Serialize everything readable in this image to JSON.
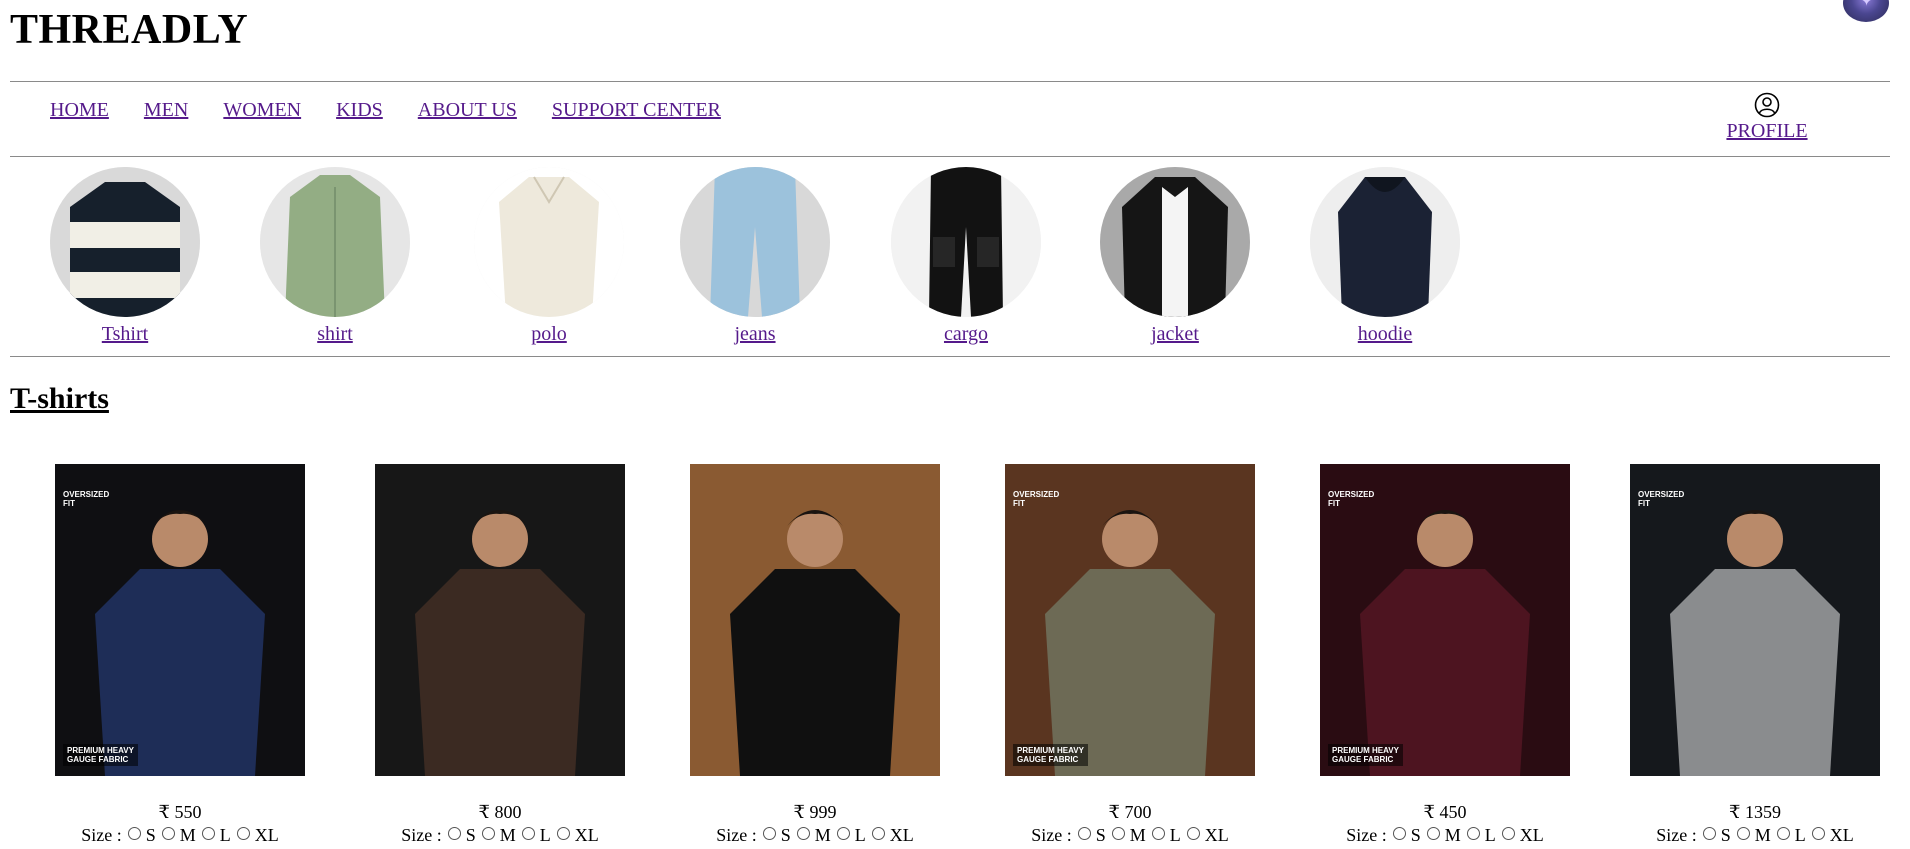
{
  "brand": "THREADLY",
  "nav": [
    "HOME",
    "MEN",
    "WOMEN",
    "KIDS",
    "ABOUT US",
    "SUPPORT CENTER"
  ],
  "profile": {
    "label": "PROFILE",
    "icon": "user-circle-icon"
  },
  "categories": [
    "Tshirt",
    "shirt",
    "polo",
    "jeans",
    "cargo",
    "jacket",
    "hoodie"
  ],
  "section_title": "T-shirts",
  "size_label": "Size :",
  "sizes": [
    "S",
    "M",
    "L",
    "XL"
  ],
  "products": [
    {
      "price": "₹ 550",
      "tag_top": "OVERSIZED\nFIT",
      "tag_bottom": "PREMIUM HEAVY\nGAUGE FABRIC",
      "bg": "#0f0f12",
      "shirt": "#1e2d57"
    },
    {
      "price": "₹ 800",
      "tag_top": "",
      "tag_bottom": "",
      "bg": "#171717",
      "shirt": "#3b2a22"
    },
    {
      "price": "₹ 999",
      "tag_top": "",
      "tag_bottom": "",
      "bg": "#8a5a32",
      "shirt": "#101010"
    },
    {
      "price": "₹ 700",
      "tag_top": "OVERSIZED\nFIT",
      "tag_bottom": "PREMIUM HEAVY\nGAUGE FABRIC",
      "bg": "#5a3520",
      "shirt": "#6d6a55"
    },
    {
      "price": "₹ 450",
      "tag_top": "OVERSIZED\nFIT",
      "tag_bottom": "PREMIUM HEAVY\nGAUGE FABRIC",
      "bg": "#2a0c12",
      "shirt": "#4d1420"
    },
    {
      "price": "₹ 1359",
      "tag_top": "OVERSIZED\nFIT",
      "tag_bottom": "",
      "bg": "#15181c",
      "shirt": "#8a8c8e"
    }
  ],
  "colors": {
    "link": "#551a8b",
    "rule": "#8a8a8a"
  }
}
